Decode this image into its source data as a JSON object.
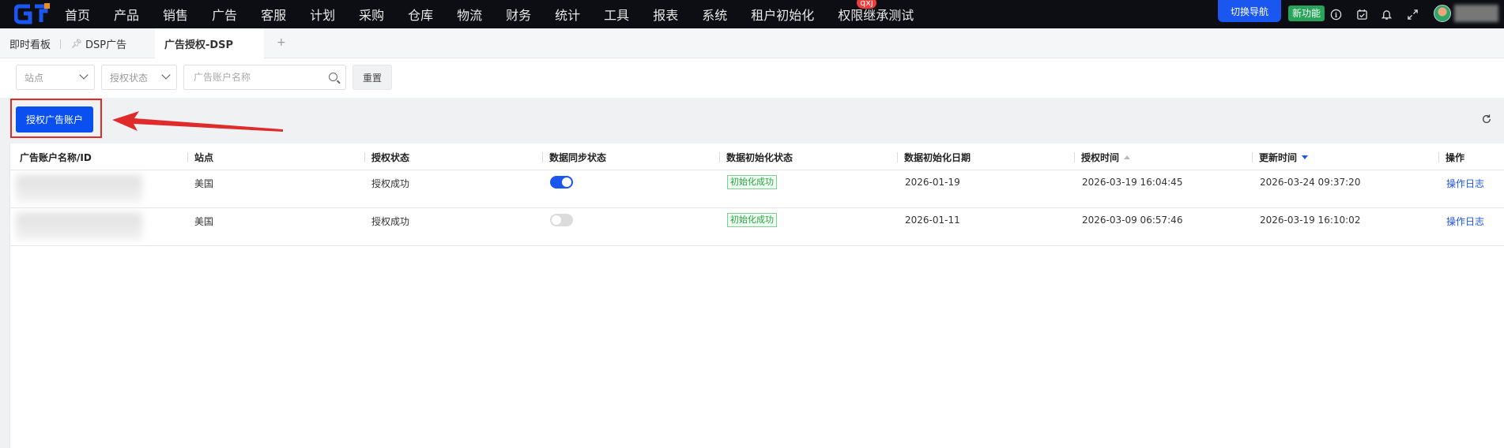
{
  "nav": {
    "items": [
      "首页",
      "产品",
      "销售",
      "广告",
      "客服",
      "计划",
      "采购",
      "仓库",
      "物流",
      "财务",
      "统计",
      "工具",
      "报表",
      "系统",
      "租户初始化",
      "权限继承测试"
    ],
    "badge": "qxj",
    "switch_nav": "切换导航",
    "new_feature": "新功能",
    "icons": [
      "info-icon",
      "calendar-check-icon",
      "bell-icon",
      "fullscreen-icon"
    ]
  },
  "tabs": {
    "items": [
      {
        "label": "即时看板"
      },
      {
        "label": "DSP广告",
        "icon": "pin-icon"
      },
      {
        "label": "广告授权-DSP",
        "active": true
      }
    ],
    "add": "+"
  },
  "filters": {
    "site_placeholder": "站点",
    "auth_status_placeholder": "授权状态",
    "search_placeholder": "广告账户名称",
    "reset_label": "重置"
  },
  "toolbar": {
    "authorize_label": "授权广告账户"
  },
  "table": {
    "columns": [
      "广告账户名称/ID",
      "站点",
      "授权状态",
      "数据同步状态",
      "数据初始化状态",
      "数据初始化日期",
      "授权时间",
      "更新时间",
      "操作"
    ],
    "rows": [
      {
        "site": "美国",
        "auth_status": "授权成功",
        "sync_on": true,
        "init_status": "初始化成功",
        "init_date": "2026-01-19",
        "auth_time": "2026-03-19 16:04:45",
        "update_time": "2026-03-24 09:37:20",
        "action": "操作日志"
      },
      {
        "site": "美国",
        "auth_status": "授权成功",
        "sync_on": false,
        "init_status": "初始化成功",
        "init_date": "2026-01-11",
        "auth_time": "2026-03-09 06:57:46",
        "update_time": "2026-03-19 16:10:02",
        "action": "操作日志"
      }
    ]
  },
  "colors": {
    "accent": "#1a56f0",
    "highlight": "#e02b2b",
    "success": "#2aa445"
  }
}
